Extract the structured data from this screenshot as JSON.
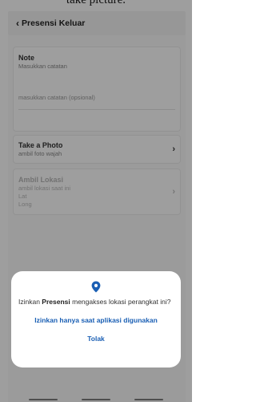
{
  "caption": "take picture.",
  "header": {
    "back_icon": "chevron-left-icon",
    "title": "Presensi Keluar"
  },
  "note": {
    "title": "Note",
    "subtitle": "Masukkan catatan",
    "placeholder": "masukkan catatan (opsional)"
  },
  "photo": {
    "title": "Take a Photo",
    "subtitle": "ambil foto wajah",
    "icon": "chevron-right-icon"
  },
  "location": {
    "title": "Ambil Lokasi",
    "subtitle": "ambil lokasi saat ini",
    "lat_label": "Lat",
    "long_label": "Long",
    "icon": "chevron-right-icon"
  },
  "permission_dialog": {
    "icon": "location-pin-icon",
    "accent": "#1a5fb4",
    "message_prefix": "Izinkan ",
    "app_name": "Presensi",
    "message_suffix": " mengakses lokasi perangkat ini?",
    "allow_label": "Izinkan hanya saat aplikasi digunakan",
    "deny_label": "Tolak"
  }
}
